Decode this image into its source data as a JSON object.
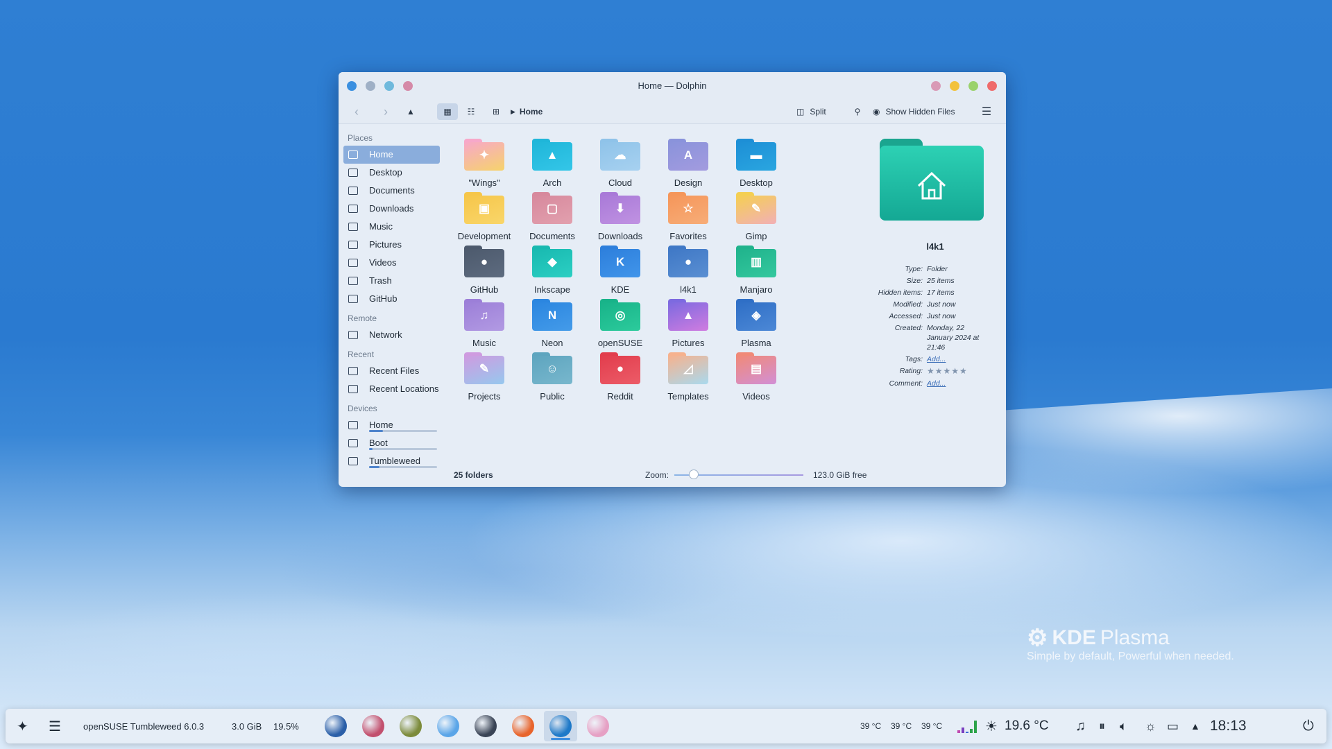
{
  "window": {
    "title": "Home — Dolphin",
    "toolbar": {
      "breadcrumb": "Home",
      "split_label": "Split",
      "hidden_files_label": "Show Hidden Files"
    }
  },
  "sidebar": {
    "places_header": "Places",
    "places": [
      {
        "label": "Home",
        "icon": "home-icon",
        "selected": true
      },
      {
        "label": "Desktop",
        "icon": "desktop-icon"
      },
      {
        "label": "Documents",
        "icon": "documents-icon"
      },
      {
        "label": "Downloads",
        "icon": "downloads-icon"
      },
      {
        "label": "Music",
        "icon": "music-icon"
      },
      {
        "label": "Pictures",
        "icon": "pictures-icon"
      },
      {
        "label": "Videos",
        "icon": "videos-icon"
      },
      {
        "label": "Trash",
        "icon": "trash-icon"
      },
      {
        "label": "GitHub",
        "icon": "github-icon"
      }
    ],
    "remote_header": "Remote",
    "remote": [
      {
        "label": "Network",
        "icon": "network-icon"
      }
    ],
    "recent_header": "Recent",
    "recent": [
      {
        "label": "Recent Files",
        "icon": "recent-files-icon"
      },
      {
        "label": "Recent Locations",
        "icon": "recent-locations-icon"
      }
    ],
    "devices_header": "Devices",
    "devices": [
      {
        "label": "Home",
        "icon": "drive-icon",
        "usage": 0.2
      },
      {
        "label": "Boot",
        "icon": "drive-icon",
        "usage": 0.05
      },
      {
        "label": "Tumbleweed",
        "icon": "drive-icon",
        "usage": 0.15
      }
    ]
  },
  "folders": [
    {
      "label": "\"Wings\"",
      "color": "#f7a8c9",
      "color2": "#f6d36b",
      "glyph": "✦"
    },
    {
      "label": "Arch",
      "color": "#1fb6d9",
      "color2": "#34c6e8",
      "glyph": "▲"
    },
    {
      "label": "Cloud",
      "color": "#8fc3e9",
      "color2": "#a7d1f0",
      "glyph": "☁"
    },
    {
      "label": "Design",
      "color": "#8a93db",
      "color2": "#a39bdf",
      "glyph": "A"
    },
    {
      "label": "Desktop",
      "color": "#1d8fd6",
      "color2": "#2aa6e0",
      "glyph": "▬"
    },
    {
      "label": "Development",
      "color": "#f6c64a",
      "color2": "#f9d66a",
      "glyph": "▣"
    },
    {
      "label": "Documents",
      "color": "#d7899d",
      "color2": "#e2a0ae",
      "glyph": "▢"
    },
    {
      "label": "Downloads",
      "color": "#a97ad8",
      "color2": "#c092e2",
      "glyph": "⬇"
    },
    {
      "label": "Favorites",
      "color": "#f5965a",
      "color2": "#f7ad78",
      "glyph": "☆"
    },
    {
      "label": "Gimp",
      "color": "#f4cf52",
      "color2": "#f2b0b6",
      "glyph": "✎"
    },
    {
      "label": "GitHub",
      "color": "#4d5a6d",
      "color2": "#5d6b7f",
      "glyph": "●"
    },
    {
      "label": "Inkscape",
      "color": "#18b9b0",
      "color2": "#2ccfc3",
      "glyph": "◆"
    },
    {
      "label": "KDE",
      "color": "#2d7fdc",
      "color2": "#4195ea",
      "glyph": "K"
    },
    {
      "label": "l4k1",
      "color": "#3f78c6",
      "color2": "#5a8fd2",
      "glyph": "●"
    },
    {
      "label": "Manjaro",
      "color": "#20b38c",
      "color2": "#34c89e",
      "glyph": "▥"
    },
    {
      "label": "Music",
      "color": "#9c7fd8",
      "color2": "#b29ae3",
      "glyph": "♫"
    },
    {
      "label": "Neon",
      "color": "#2b86e0",
      "color2": "#449be9",
      "glyph": "N"
    },
    {
      "label": "openSUSE",
      "color": "#18b389",
      "color2": "#2ccb9c",
      "glyph": "◎"
    },
    {
      "label": "Pictures",
      "color": "#7d6ae0",
      "color2": "#d07ce0",
      "glyph": "▲"
    },
    {
      "label": "Plasma",
      "color": "#2f6fc6",
      "color2": "#4c88d6",
      "glyph": "◈"
    },
    {
      "label": "Projects",
      "color": "#cf9be0",
      "color2": "#96c8ee",
      "glyph": "✎"
    },
    {
      "label": "Public",
      "color": "#5ea5bf",
      "color2": "#78b7cd",
      "glyph": "☺"
    },
    {
      "label": "Reddit",
      "color": "#e23d4d",
      "color2": "#ec5c68",
      "glyph": "●"
    },
    {
      "label": "Templates",
      "color": "#f6b28e",
      "color2": "#a9d9ee",
      "glyph": "◿"
    },
    {
      "label": "Videos",
      "color": "#f08a78",
      "color2": "#d28fd6",
      "glyph": "▤"
    }
  ],
  "info_panel": {
    "name": "l4k1",
    "rows": [
      {
        "key": "Type:",
        "value": "Folder"
      },
      {
        "key": "Size:",
        "value": "25 items"
      },
      {
        "key": "Hidden items:",
        "value": "17 items"
      },
      {
        "key": "Modified:",
        "value": "Just now"
      },
      {
        "key": "Accessed:",
        "value": "Just now"
      },
      {
        "key": "Created:",
        "value": "Monday, 22 January 2024 at 21:46"
      },
      {
        "key": "Tags:",
        "value": "Add...",
        "link": true
      },
      {
        "key": "Rating:",
        "value": "★★★★★",
        "stars": true
      },
      {
        "key": "Comment:",
        "value": "Add...",
        "link": true
      }
    ]
  },
  "statusbar": {
    "folder_count": "25 folders",
    "zoom_label": "Zoom:",
    "zoom_level": 0.15,
    "free_space": "123.0 GiB free"
  },
  "desktop": {
    "kde_brand": "KDE",
    "kde_product": "Plasma",
    "kde_slogan": "Simple by default, Powerful when  needed."
  },
  "taskbar": {
    "distro_label": "openSUSE Tumbleweed 6.0.3",
    "ram": "3.0 GiB",
    "cpu": "19.5%",
    "apps": [
      {
        "icon": "system-monitor-icon",
        "color": "#2b5fa8"
      },
      {
        "icon": "dev-app-icon",
        "color": "#c2506e"
      },
      {
        "icon": "game-icon",
        "color": "#7c8b3b"
      },
      {
        "icon": "discover-icon",
        "color": "#5aa5e8"
      },
      {
        "icon": "settings-app-icon",
        "color": "#3a4456"
      },
      {
        "icon": "firefox-icon",
        "color": "#e8642c"
      },
      {
        "icon": "dolphin-icon",
        "color": "#1e79c8",
        "active": true
      },
      {
        "icon": "kate-icon",
        "color": "#e6a0c4"
      }
    ],
    "temps": [
      "39 °C",
      "39 °C",
      "39 °C"
    ],
    "weather": "19.6 °C",
    "clock": "18:13"
  }
}
